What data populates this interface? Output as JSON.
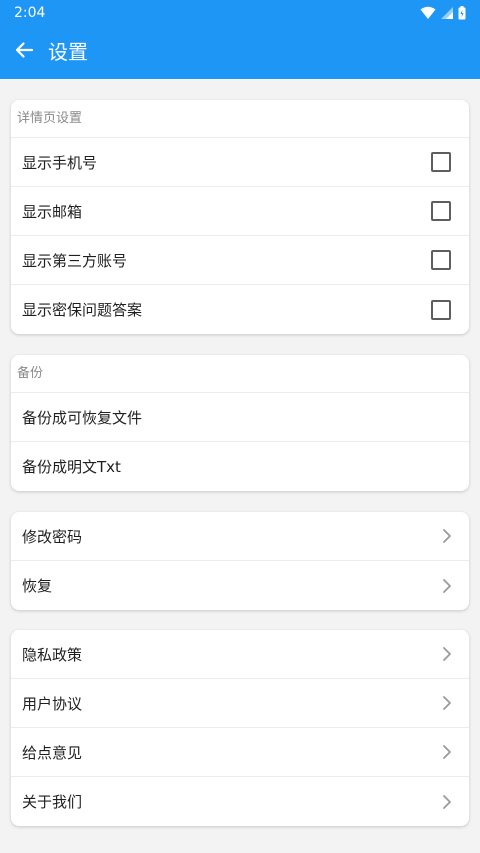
{
  "status_bar": {
    "time": "2:04"
  },
  "app_bar": {
    "title": "设置"
  },
  "detail_section": {
    "header": "详情页设置",
    "items": [
      {
        "label": "显示手机号",
        "checked": false
      },
      {
        "label": "显示邮箱",
        "checked": false
      },
      {
        "label": "显示第三方账号",
        "checked": false
      },
      {
        "label": "显示密保问题答案",
        "checked": false
      }
    ]
  },
  "backup_section": {
    "header": "备份",
    "items": [
      {
        "label": "备份成可恢复文件"
      },
      {
        "label": "备份成明文Txt"
      }
    ]
  },
  "security_section": {
    "items": [
      {
        "label": "修改密码"
      },
      {
        "label": "恢复"
      }
    ]
  },
  "about_section": {
    "items": [
      {
        "label": "隐私政策"
      },
      {
        "label": "用户协议"
      },
      {
        "label": "给点意见"
      },
      {
        "label": "关于我们"
      }
    ]
  },
  "colors": {
    "primary": "#1e96f5",
    "background": "#f3f3f3",
    "card": "#ffffff",
    "text": "#1f1f1f",
    "subtext": "#8a8a8a"
  }
}
